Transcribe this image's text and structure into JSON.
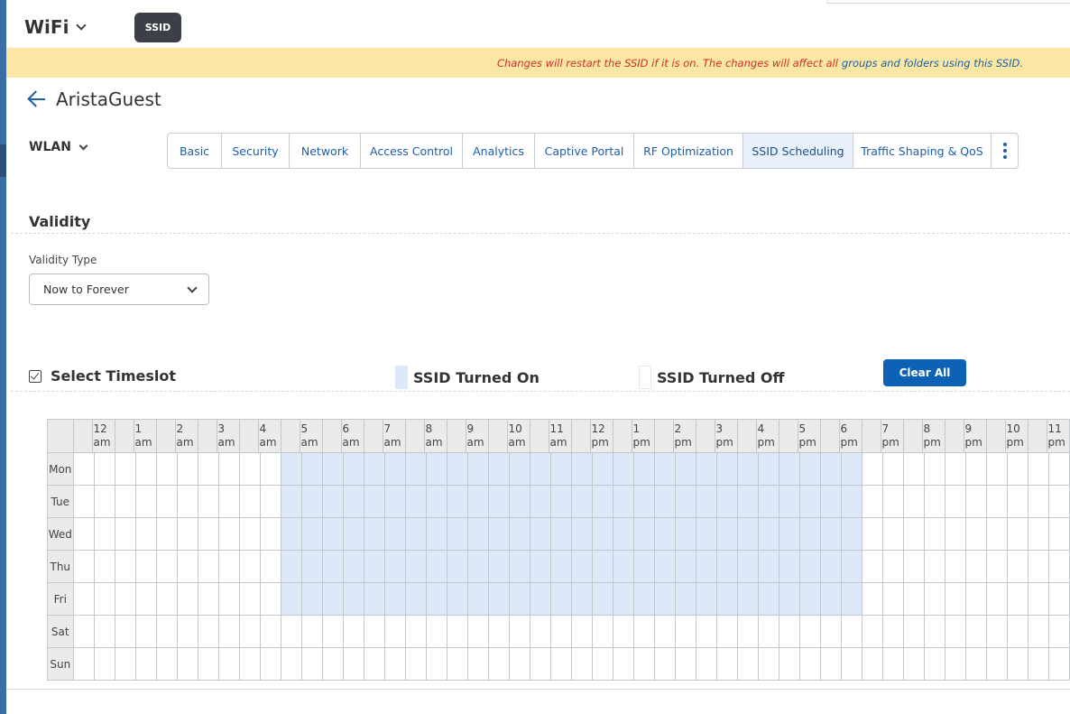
{
  "app": {
    "title": "WiFi",
    "badge": "SSID"
  },
  "banner": {
    "warning": "Changes will restart the SSID if it is on. The changes will affect all",
    "info": "groups and folders using this SSID."
  },
  "page": {
    "title": "AristaGuest"
  },
  "wlan": {
    "label": "WLAN"
  },
  "tabs": [
    {
      "label": "Basic",
      "active": false
    },
    {
      "label": "Security",
      "active": false
    },
    {
      "label": "Network",
      "active": false
    },
    {
      "label": "Access Control",
      "active": false
    },
    {
      "label": "Analytics",
      "active": false
    },
    {
      "label": "Captive Portal",
      "active": false
    },
    {
      "label": "RF Optimization",
      "active": false
    },
    {
      "label": "SSID Scheduling",
      "active": true
    },
    {
      "label": "Traffic Shaping & QoS",
      "active": false
    }
  ],
  "validity": {
    "section_title": "Validity",
    "type_label": "Validity Type",
    "type_value": "Now to Forever"
  },
  "timeslot": {
    "select_label": "Select Timeslot",
    "selected": true,
    "legend_on": "SSID Turned On",
    "legend_off": "SSID Turned Off",
    "clear_label": "Clear All",
    "hours": [
      {
        "h": "12",
        "p": "am"
      },
      {
        "h": "1",
        "p": "am"
      },
      {
        "h": "2",
        "p": "am"
      },
      {
        "h": "3",
        "p": "am"
      },
      {
        "h": "4",
        "p": "am"
      },
      {
        "h": "5",
        "p": "am"
      },
      {
        "h": "6",
        "p": "am"
      },
      {
        "h": "7",
        "p": "am"
      },
      {
        "h": "8",
        "p": "am"
      },
      {
        "h": "9",
        "p": "am"
      },
      {
        "h": "10",
        "p": "am"
      },
      {
        "h": "11",
        "p": "am"
      },
      {
        "h": "12",
        "p": "pm"
      },
      {
        "h": "1",
        "p": "pm"
      },
      {
        "h": "2",
        "p": "pm"
      },
      {
        "h": "3",
        "p": "pm"
      },
      {
        "h": "4",
        "p": "pm"
      },
      {
        "h": "5",
        "p": "pm"
      },
      {
        "h": "6",
        "p": "pm"
      },
      {
        "h": "7",
        "p": "pm"
      },
      {
        "h": "8",
        "p": "pm"
      },
      {
        "h": "9",
        "p": "pm"
      },
      {
        "h": "10",
        "p": "pm"
      },
      {
        "h": "11",
        "p": "pm"
      }
    ],
    "days": [
      "Mon",
      "Tue",
      "Wed",
      "Thu",
      "Fri",
      "Sat",
      "Sun"
    ],
    "on_days": [
      "Mon",
      "Tue",
      "Wed",
      "Thu",
      "Fri"
    ],
    "on_start_hour": 5,
    "on_end_hour": 19
  },
  "colors": {
    "accent": "#0d62b6",
    "on_cell": "#dde9fb",
    "banner": "#fbe7a4",
    "warning_text": "#cf2e2e"
  }
}
